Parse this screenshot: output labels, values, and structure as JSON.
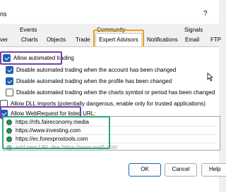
{
  "window": {
    "title": "ns",
    "help_label": "?"
  },
  "tabs_top": [
    "Events",
    "Community",
    "Signals"
  ],
  "tabs_bottom": [
    "ver",
    "Charts",
    "Objects",
    "Trade",
    "Expert Advisors",
    "Notifications",
    "Email",
    "FTP"
  ],
  "options": [
    {
      "label": "Allow automated trading",
      "checked": true
    },
    {
      "label": "Disable automated trading when the account has been changed",
      "checked": true
    },
    {
      "label": "Disable automated trading when the profile has been changed",
      "checked": true
    },
    {
      "label": "Disable automated trading when the charts symbol or period has been changed",
      "checked": false
    },
    {
      "label": "Allow DLL imports (potentially dangerous, enable only for trusted applications)",
      "checked": false
    },
    {
      "label": "Allow WebRequest for listed URL:",
      "checked": true
    }
  ],
  "urls": [
    "https://nfs.faireconomy.media",
    "https://www.investing.com",
    "https://ec.forexprostools.com",
    "add new URL like 'https://www.mql5.com'"
  ],
  "buttons": {
    "ok": "OK",
    "cancel": "Cancel",
    "help": "Help"
  },
  "colors": {
    "check_accent": "#1a5fb4",
    "highlight_purple": "#7b3fa6",
    "highlight_orange": "#e8a21c",
    "highlight_green": "#2aa57a"
  }
}
